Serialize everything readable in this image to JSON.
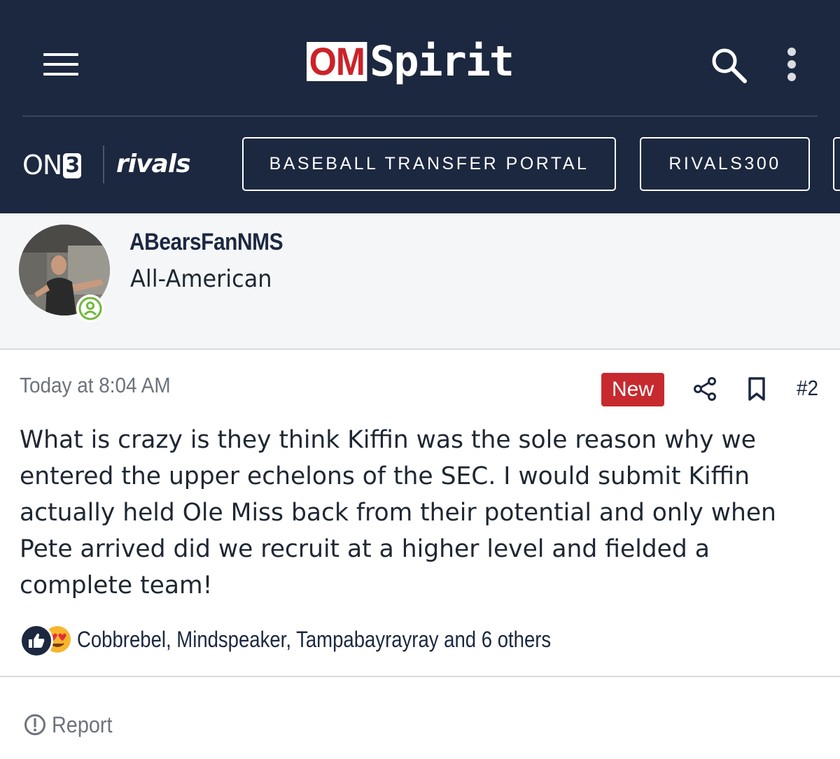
{
  "header": {
    "logo_om": "OM",
    "logo_spirit": "Spirit",
    "brand_on3_prefix": "ON",
    "brand_on3_suffix": "3",
    "brand_rivals": "rivals",
    "nav_buttons": [
      "BASEBALL TRANSFER PORTAL",
      "RIVALS300"
    ]
  },
  "user": {
    "username": "ABearsFanNMS",
    "title": "All-American"
  },
  "post": {
    "date": "Today at 8:04 AM",
    "new_badge": "New",
    "number": "#2",
    "body": "What is crazy is they think Kiffin was the sole reason why we entered the upper echelons of the SEC. I would submit Kiffin actually held Ole Miss back from their potential and only when Pete arrived did we recruit at a higher level and fielded a complete team!",
    "reactions_text": "Cobbrebel, Mindspeaker, Tampabayrayray and 6 others",
    "report_label": "Report"
  },
  "colors": {
    "header_bg": "#1c2840",
    "accent_red": "#c62a2f",
    "online_green": "#6fb83a"
  },
  "icons": [
    "menu-icon",
    "search-icon",
    "more-vertical-icon",
    "online-status-icon",
    "share-icon",
    "bookmark-icon",
    "like-icon",
    "love-icon",
    "report-icon"
  ]
}
